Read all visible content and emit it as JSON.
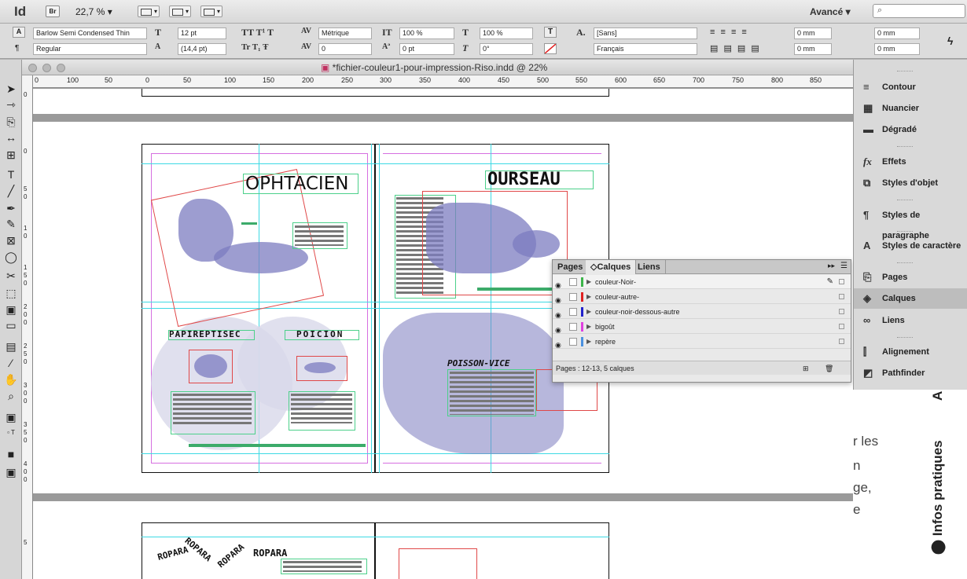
{
  "app": {
    "logo": "Id",
    "bridge": "Br",
    "zoom": "22,7 % ▾",
    "workspace": "Avancé ▾",
    "search_placeholder": "⌕"
  },
  "control": {
    "font_family": "Barlow Semi Condensed Thin",
    "font_style": "Regular",
    "font_size": "12 pt",
    "leading": "(14,4 pt)",
    "kerning": "Métrique",
    "tracking": "0",
    "vscale": "100 %",
    "hscale": "100 %",
    "baseline": "0 pt",
    "skew": "0°",
    "char_style": "[Sans]",
    "language": "Français",
    "indent1": "0 mm",
    "indent2": "0 mm",
    "indent3": "0 mm",
    "indent4": "0 mm"
  },
  "document": {
    "title": "*fichier-couleur1-pour-impression-Riso.indd @ 22%",
    "ruler_labels": [
      "0",
      "100",
      "50",
      "0",
      "50",
      "100",
      "150",
      "200",
      "250",
      "300",
      "350",
      "400",
      "450",
      "500",
      "550",
      "600",
      "650",
      "700",
      "750",
      "800",
      "850"
    ],
    "vruler_labels": [
      "0",
      "0",
      "5",
      "0",
      "1",
      "0",
      "1",
      "5",
      "0",
      "2",
      "0",
      "0",
      "2",
      "5",
      "0",
      "3",
      "0",
      "0",
      "3",
      "5",
      "0",
      "4",
      "0",
      "0",
      "5"
    ],
    "words": {
      "ophtacien": "OPHTACIEN",
      "ourseau": "OURSEAU",
      "papirep": "PAPIREPTISEC",
      "poicion": "POICION",
      "poisson": "POISSON-VICE",
      "ropara": "ROPARA"
    }
  },
  "layers_panel": {
    "tabs": [
      "Pages",
      "◇Calques",
      "Liens"
    ],
    "layers": [
      {
        "name": "couleur-Noir-",
        "color": "#3cb54a"
      },
      {
        "name": "couleur-autre-",
        "color": "#e02020"
      },
      {
        "name": "couleur-noir-dessous-autre",
        "color": "#2222cc"
      },
      {
        "name": "bigoût",
        "color": "#e040e0"
      },
      {
        "name": "repère",
        "color": "#4a90e0"
      }
    ],
    "footer": "Pages : 12-13, 5 calques"
  },
  "dock": {
    "items": [
      {
        "label": "Contour",
        "icon": "≡"
      },
      {
        "label": "Nuancier",
        "icon": "▦"
      },
      {
        "label": "Dégradé",
        "icon": "▬"
      },
      {
        "label": "Effets",
        "icon": "fx"
      },
      {
        "label": "Styles d'objet",
        "icon": "⧉"
      },
      {
        "label": "Styles de paragraphe",
        "icon": "¶"
      },
      {
        "label": "Styles de caractère",
        "icon": "A"
      },
      {
        "label": "Pages",
        "icon": "⎘"
      },
      {
        "label": "Calques",
        "icon": "◈"
      },
      {
        "label": "Liens",
        "icon": "∞"
      },
      {
        "label": "Alignement",
        "icon": "⫿"
      },
      {
        "label": "Pathfinder",
        "icon": "◩"
      }
    ]
  },
  "background_web": {
    "lines": [
      "r les",
      "n",
      "ge,",
      "e"
    ],
    "vertical": "Infos pratiques",
    "vertical_partial": "A"
  }
}
